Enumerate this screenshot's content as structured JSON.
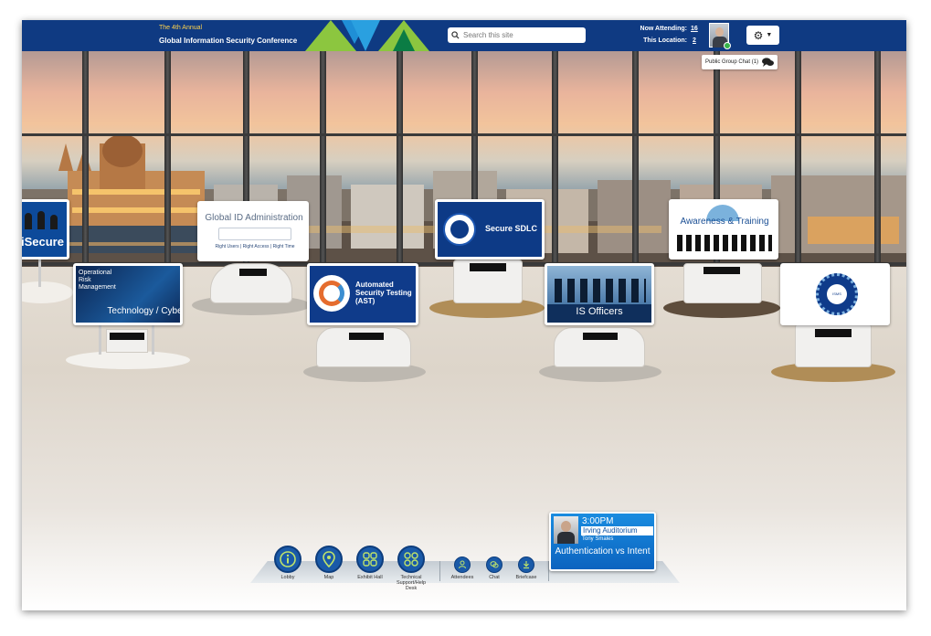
{
  "header": {
    "conference_line1": "The 4th Annual",
    "conference_line2": "Global Information Security Conference",
    "search_placeholder": "Search this site",
    "now_attending_label": "Now Attending:",
    "now_attending_count": "16",
    "this_location_label": "This Location:",
    "this_location_count": "2",
    "group_chat_label": "Public Group Chat (1)",
    "colors": {
      "bar": "#0f3a82",
      "accent_green": "#8cc63f",
      "accent_blue": "#1f8fd6",
      "accent_yellow": "#ffd34d"
    }
  },
  "booths": [
    {
      "name": "iSecure"
    },
    {
      "name": "Global ID Administration",
      "tags": "Right Users | Right Access | Right Time"
    },
    {
      "name": "Secure SDLC"
    },
    {
      "name": "Awareness & Training"
    },
    {
      "name": "Operational Risk Management",
      "footer": "Technology / Cyber"
    },
    {
      "name": "Automated Security Testing (AST)"
    },
    {
      "name": "IS Officers"
    },
    {
      "name": "ISMS"
    }
  ],
  "session": {
    "time": "3:00PM",
    "location": "Irving Auditorium",
    "speaker": "Tony Smales",
    "title": "Authentication vs Intent"
  },
  "dock": [
    {
      "label": "Lobby",
      "icon": "info-icon"
    },
    {
      "label": "Map",
      "icon": "map-pin-icon"
    },
    {
      "label": "Exhibit Hall",
      "icon": "grid-icon"
    },
    {
      "label": "Technical Support/Help Desk",
      "icon": "support-icon"
    },
    {
      "label": "Attendees",
      "icon": "people-icon"
    },
    {
      "label": "Chat",
      "icon": "chat-icon"
    },
    {
      "label": "Briefcase",
      "icon": "download-icon"
    }
  ]
}
